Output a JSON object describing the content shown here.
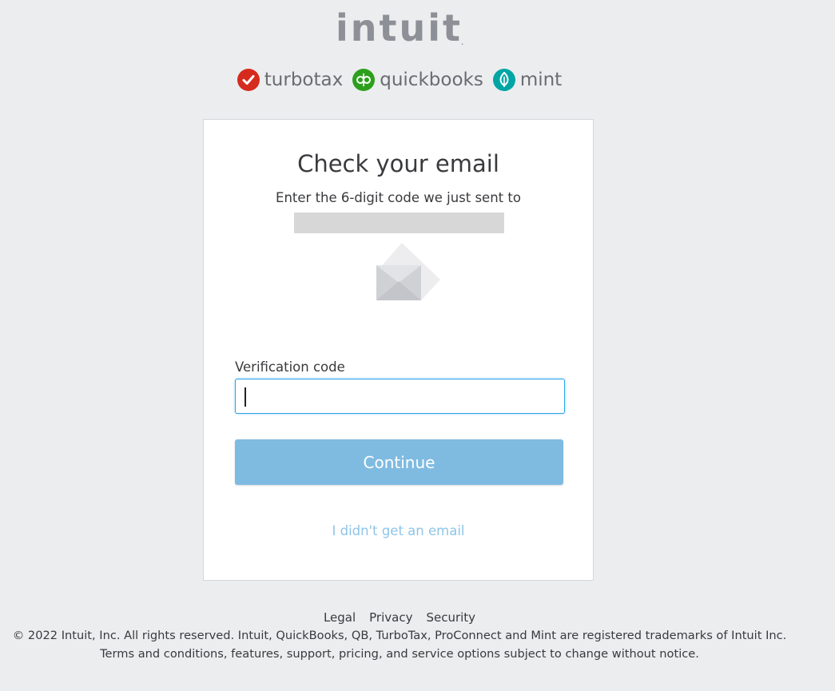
{
  "header": {
    "logo_text": "intuit",
    "logo_tm": ".",
    "brands": [
      {
        "name": "turbotax",
        "icon": "turbotax-check-icon",
        "color": "#d52b1e"
      },
      {
        "name": "quickbooks",
        "icon": "quickbooks-qb-icon",
        "color": "#2ca01c"
      },
      {
        "name": "mint",
        "icon": "mint-leaf-icon",
        "color": "#00a6a4"
      }
    ]
  },
  "card": {
    "title": "Check your email",
    "subtitle": "Enter the 6-digit code we just sent to",
    "field_label": "Verification code",
    "field_value": "",
    "continue_label": "Continue",
    "no_email_link": "I didn't get an email"
  },
  "footer": {
    "links": [
      "Legal",
      "Privacy",
      "Security"
    ],
    "copyright": "© 2022 Intuit, Inc. All rights reserved. Intuit, QuickBooks, QB, TurboTax, ProConnect and Mint are registered trademarks of Intuit Inc.",
    "terms": "Terms and conditions, features, support, pricing, and service options subject to change without notice."
  },
  "colors": {
    "background": "#ecedef",
    "button": "#7fbbe1",
    "link": "#8ec5e8",
    "input_focus": "#2ca3e8"
  }
}
